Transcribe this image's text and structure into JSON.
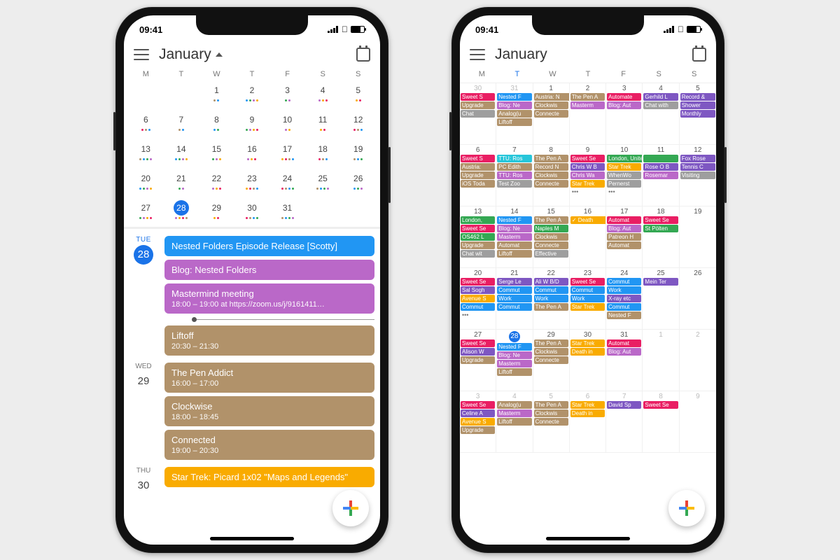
{
  "status": {
    "time": "09:41"
  },
  "header": {
    "month": "January"
  },
  "dow": [
    "M",
    "T",
    "W",
    "T",
    "F",
    "S",
    "S"
  ],
  "left_phone": {
    "mini_weeks": [
      [
        "",
        "",
        "1",
        "2",
        "3",
        "4",
        "5"
      ],
      [
        "6",
        "7",
        "8",
        "9",
        "10",
        "11",
        "12"
      ],
      [
        "13",
        "14",
        "15",
        "16",
        "17",
        "18",
        "19"
      ],
      [
        "20",
        "21",
        "22",
        "23",
        "24",
        "25",
        "26"
      ],
      [
        "27",
        "28",
        "29",
        "30",
        "31",
        "",
        ""
      ]
    ],
    "today": "28",
    "agenda": [
      {
        "dow": "TUE",
        "num": "28",
        "today": true,
        "events": [
          {
            "title": "Nested Folders Episode Release [Scotty]",
            "sub": "",
            "color": "c-blue"
          },
          {
            "title": "Blog: Nested Folders",
            "sub": "",
            "color": "c-mag"
          },
          {
            "title": "Mastermind meeting",
            "sub": "18:00 – 19:00 at https://zoom.us/j/9161411…",
            "color": "c-mag"
          },
          {
            "title": "Liftoff",
            "sub": "20:30 – 21:30",
            "color": "c-tan",
            "after_now": true
          }
        ]
      },
      {
        "dow": "WED",
        "num": "29",
        "events": [
          {
            "title": "The Pen Addict",
            "sub": "16:00 – 17:00",
            "color": "c-tan"
          },
          {
            "title": "Clockwise",
            "sub": "18:00 – 18:45",
            "color": "c-tan"
          },
          {
            "title": "Connected",
            "sub": "19:00 – 20:30",
            "color": "c-tan"
          }
        ]
      },
      {
        "dow": "THU",
        "num": "30",
        "events": [
          {
            "title": "Star Trek: Picard 1x02 \"Maps and Legends\"",
            "sub": "",
            "color": "c-ylw"
          }
        ]
      }
    ]
  },
  "right_phone": {
    "today": 28,
    "days": [
      {
        "n": 30,
        "dim": true,
        "ev": [
          {
            "t": "Sweet S",
            "c": "c-pink"
          },
          {
            "t": "Upgrade",
            "c": "c-tan"
          },
          {
            "t": "Chat",
            "c": "c-gray"
          }
        ]
      },
      {
        "n": 31,
        "dim": true,
        "ev": [
          {
            "t": "Nested F",
            "c": "c-blue"
          },
          {
            "t": "Blog: Ne",
            "c": "c-mag"
          },
          {
            "t": "Analog(u",
            "c": "c-tan"
          },
          {
            "t": "Liftoff",
            "c": "c-tan"
          }
        ]
      },
      {
        "n": 1,
        "ev": [
          {
            "t": "Austria: N",
            "c": "c-tan",
            "sp": true
          },
          {
            "t": "Clockwis",
            "c": "c-tan"
          },
          {
            "t": "Connecte",
            "c": "c-tan"
          }
        ]
      },
      {
        "n": 2,
        "ev": [
          {
            "t": "The Pen A",
            "c": "c-tan"
          },
          {
            "t": "Masterm",
            "c": "c-mag"
          }
        ]
      },
      {
        "n": 3,
        "ev": [
          {
            "t": "Automate",
            "c": "c-pink"
          },
          {
            "t": "Blog: Aut",
            "c": "c-mag"
          }
        ]
      },
      {
        "n": 4,
        "ev": [
          {
            "t": "Gerhild L",
            "c": "c-pur"
          },
          {
            "t": "Chat with",
            "c": "c-gray"
          }
        ]
      },
      {
        "n": 5,
        "ev": [
          {
            "t": "Record &",
            "c": "c-pur"
          },
          {
            "t": "Shower",
            "c": "c-pur"
          },
          {
            "t": "Monthly",
            "c": "c-pur"
          }
        ]
      },
      {
        "n": 6,
        "ev": [
          {
            "t": "Sweet S",
            "c": "c-pink"
          },
          {
            "t": "Austria:",
            "c": "c-tan"
          },
          {
            "t": "Upgrade",
            "c": "c-tan"
          },
          {
            "t": "iOS Toda",
            "c": "c-tan"
          }
        ]
      },
      {
        "n": 7,
        "ev": [
          {
            "t": "TTU: Ros",
            "c": "c-lbl"
          },
          {
            "t": "PC Edith",
            "c": "c-tan"
          },
          {
            "t": "TTU: Ros",
            "c": "c-mag"
          },
          {
            "t": "Test Zoo",
            "c": "c-gray"
          }
        ]
      },
      {
        "n": 8,
        "ev": [
          {
            "t": "The Pen A",
            "c": "c-tan"
          },
          {
            "t": "Record N",
            "c": "c-tan"
          },
          {
            "t": "Clockwis",
            "c": "c-tan"
          },
          {
            "t": "Connecte",
            "c": "c-tan"
          }
        ]
      },
      {
        "n": 9,
        "ev": [
          {
            "t": "Sweet Se",
            "c": "c-pink"
          },
          {
            "t": "Chris W B",
            "c": "c-pur"
          },
          {
            "t": "Chris Wa",
            "c": "c-mag"
          },
          {
            "t": "Star Trek",
            "c": "c-ylw"
          }
        ],
        "more": true
      },
      {
        "n": 10,
        "ev": [
          {
            "t": "London, United Kingdom, Janu",
            "c": "c-grn",
            "sp": true
          },
          {
            "t": "Star Trek",
            "c": "c-ylw"
          },
          {
            "t": "WhenWo",
            "c": "c-gray"
          },
          {
            "t": "Pernerst",
            "c": "c-gray"
          }
        ],
        "more": true
      },
      {
        "n": 11,
        "ev": [
          {
            "t": "",
            "c": "c-grn"
          },
          {
            "t": "Rose O B",
            "c": "c-pur"
          },
          {
            "t": "Rosemar",
            "c": "c-mag"
          }
        ]
      },
      {
        "n": 12,
        "ev": [
          {
            "t": "Fox Rose",
            "c": "c-pur"
          },
          {
            "t": "Tennis C",
            "c": "c-pur"
          },
          {
            "t": "Visiting",
            "c": "c-gray"
          }
        ]
      },
      {
        "n": 13,
        "ev": [
          {
            "t": "London,",
            "c": "c-grn"
          },
          {
            "t": "Sweet Se",
            "c": "c-pink"
          },
          {
            "t": "OS462 L",
            "c": "c-grn"
          },
          {
            "t": "Upgrade",
            "c": "c-tan"
          },
          {
            "t": "Chat wit",
            "c": "c-gray"
          }
        ]
      },
      {
        "n": 14,
        "ev": [
          {
            "t": "Nested F",
            "c": "c-blue"
          },
          {
            "t": "Blog: Ne",
            "c": "c-mag"
          },
          {
            "t": "Masterm",
            "c": "c-mag"
          },
          {
            "t": "Automat",
            "c": "c-tan"
          },
          {
            "t": "Liftoff",
            "c": "c-tan"
          }
        ]
      },
      {
        "n": 15,
        "ev": [
          {
            "t": "The Pen A",
            "c": "c-tan"
          },
          {
            "t": "Naples M",
            "c": "c-grn"
          },
          {
            "t": "Clockwis",
            "c": "c-tan"
          },
          {
            "t": "Connecte",
            "c": "c-tan"
          },
          {
            "t": "Effective",
            "c": "c-gray"
          }
        ]
      },
      {
        "n": 16,
        "ev": [
          {
            "t": "✓ Death",
            "c": "c-ylw",
            "sp": true
          }
        ]
      },
      {
        "n": 17,
        "ev": [
          {
            "t": "Automat",
            "c": "c-pink"
          },
          {
            "t": "Blog: Aut",
            "c": "c-mag"
          },
          {
            "t": "Patreon H",
            "c": "c-tan"
          },
          {
            "t": "Automat",
            "c": "c-tan"
          }
        ]
      },
      {
        "n": 18,
        "ev": [
          {
            "t": "Sweet Se",
            "c": "c-pink"
          },
          {
            "t": "St Pölten",
            "c": "c-grn"
          }
        ]
      },
      {
        "n": 19,
        "ev": []
      },
      {
        "n": 20,
        "ev": [
          {
            "t": "Sweet Se",
            "c": "c-pink"
          },
          {
            "t": "Sal Sogh",
            "c": "c-pur"
          },
          {
            "t": "Avenue S",
            "c": "c-ylw"
          },
          {
            "t": "Commut",
            "c": "c-blue"
          }
        ],
        "more": true
      },
      {
        "n": 21,
        "ev": [
          {
            "t": "Serge Le",
            "c": "c-pur"
          },
          {
            "t": "Commut",
            "c": "c-blue"
          },
          {
            "t": "Work",
            "c": "c-blue"
          },
          {
            "t": "Commut",
            "c": "c-blue"
          }
        ]
      },
      {
        "n": 22,
        "ev": [
          {
            "t": "Ali W B/D",
            "c": "c-pur"
          },
          {
            "t": "Commut",
            "c": "c-blue"
          },
          {
            "t": "Work",
            "c": "c-blue"
          },
          {
            "t": "The Pen A",
            "c": "c-tan"
          }
        ]
      },
      {
        "n": 23,
        "ev": [
          {
            "t": "Sweet Se",
            "c": "c-pink"
          },
          {
            "t": "Commut",
            "c": "c-blue"
          },
          {
            "t": "Work",
            "c": "c-blue"
          },
          {
            "t": "Star Trek",
            "c": "c-ylw"
          }
        ]
      },
      {
        "n": 24,
        "ev": [
          {
            "t": "Commut",
            "c": "c-blue"
          },
          {
            "t": "Work",
            "c": "c-blue"
          },
          {
            "t": "X-ray etc",
            "c": "c-pur"
          },
          {
            "t": "Commut",
            "c": "c-blue"
          },
          {
            "t": "Nested F",
            "c": "c-tan"
          }
        ]
      },
      {
        "n": 25,
        "ev": [
          {
            "t": "Mein Ter",
            "c": "c-pur"
          }
        ]
      },
      {
        "n": 26,
        "ev": []
      },
      {
        "n": 27,
        "ev": [
          {
            "t": "Sweet Se",
            "c": "c-pink"
          },
          {
            "t": "Alison W",
            "c": "c-pur"
          },
          {
            "t": "Upgrade",
            "c": "c-tan"
          }
        ]
      },
      {
        "n": 28,
        "today": true,
        "ev": [
          {
            "t": "Nested F",
            "c": "c-blue"
          },
          {
            "t": "Blog: Ne",
            "c": "c-mag"
          },
          {
            "t": "Masterm",
            "c": "c-mag"
          },
          {
            "t": "Liftoff",
            "c": "c-tan"
          }
        ]
      },
      {
        "n": 29,
        "ev": [
          {
            "t": "The Pen A",
            "c": "c-tan"
          },
          {
            "t": "Clockwis",
            "c": "c-tan"
          },
          {
            "t": "Connecte",
            "c": "c-tan"
          }
        ]
      },
      {
        "n": 30,
        "ev": [
          {
            "t": "Star Trek",
            "c": "c-ylw"
          },
          {
            "t": "Death in",
            "c": "c-ylw"
          }
        ]
      },
      {
        "n": 31,
        "ev": [
          {
            "t": "Automat",
            "c": "c-pink"
          },
          {
            "t": "Blog: Aut",
            "c": "c-mag"
          }
        ]
      },
      {
        "n": 1,
        "dim": true,
        "ev": []
      },
      {
        "n": 2,
        "dim": true,
        "ev": []
      },
      {
        "n": 3,
        "dim": true,
        "ev": [
          {
            "t": "Sweet Se",
            "c": "c-pink"
          },
          {
            "t": "Celine A",
            "c": "c-pur"
          },
          {
            "t": "Avenue S",
            "c": "c-ylw"
          },
          {
            "t": "Upgrade",
            "c": "c-tan"
          }
        ]
      },
      {
        "n": 4,
        "dim": true,
        "ev": [
          {
            "t": "Analog(u",
            "c": "c-tan"
          },
          {
            "t": "Masterm",
            "c": "c-mag"
          },
          {
            "t": "Liftoff",
            "c": "c-tan"
          }
        ]
      },
      {
        "n": 5,
        "dim": true,
        "ev": [
          {
            "t": "The Pen A",
            "c": "c-tan"
          },
          {
            "t": "Clockwis",
            "c": "c-tan"
          },
          {
            "t": "Connecte",
            "c": "c-tan"
          }
        ]
      },
      {
        "n": 6,
        "dim": true,
        "ev": [
          {
            "t": "Star Trek",
            "c": "c-ylw"
          },
          {
            "t": "Death in",
            "c": "c-ylw"
          }
        ]
      },
      {
        "n": 7,
        "dim": true,
        "ev": [
          {
            "t": "David Sp",
            "c": "c-pur"
          }
        ]
      },
      {
        "n": 8,
        "dim": true,
        "ev": [
          {
            "t": "Sweet Se",
            "c": "c-pink"
          }
        ]
      },
      {
        "n": 9,
        "dim": true,
        "ev": []
      }
    ]
  }
}
